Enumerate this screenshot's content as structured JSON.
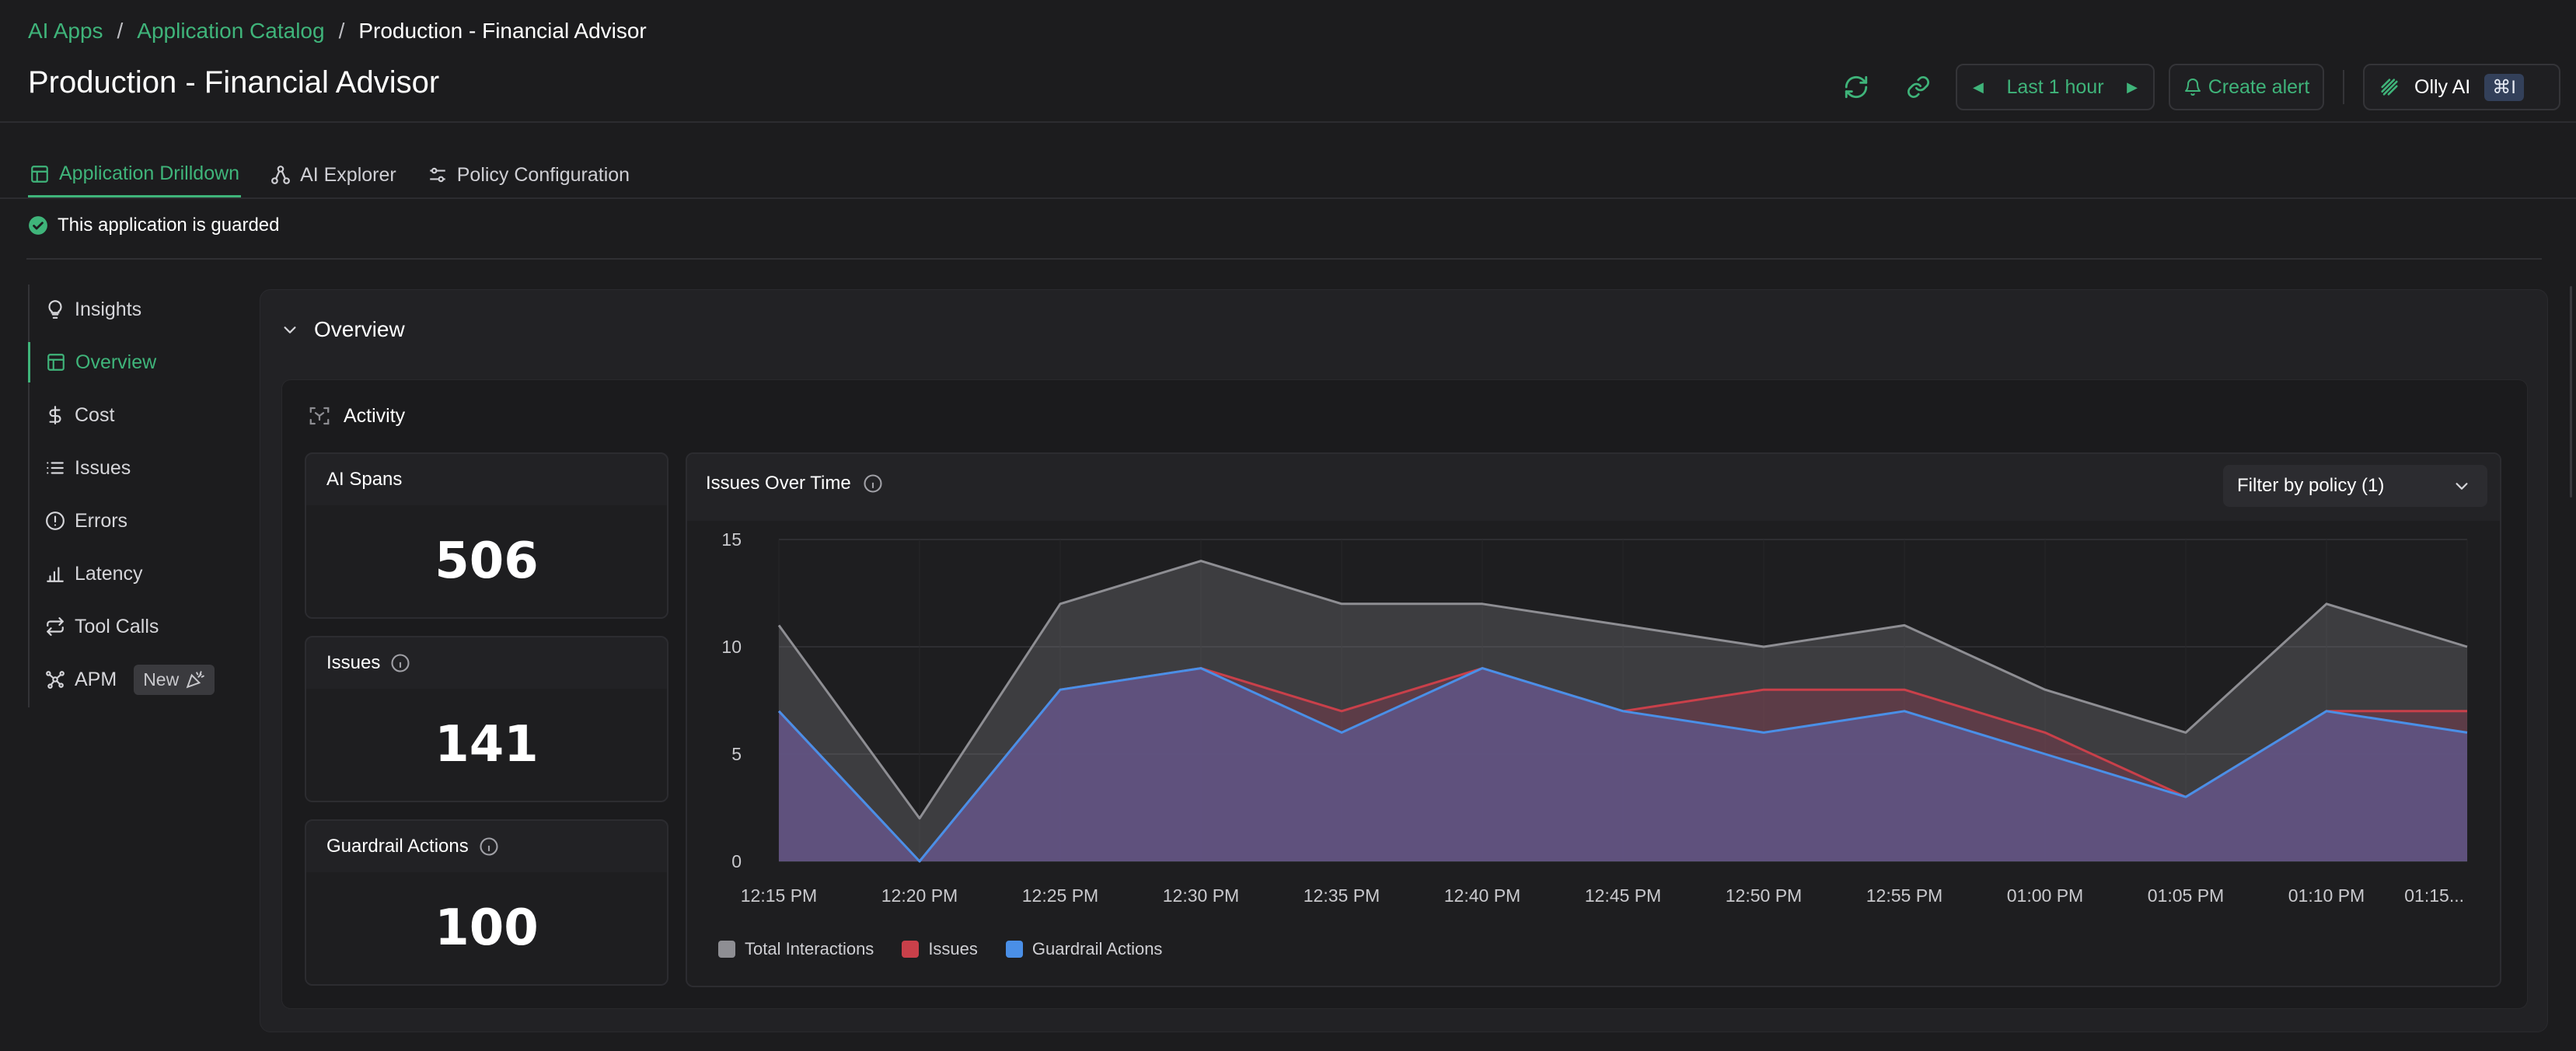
{
  "breadcrumb": {
    "items": [
      "AI Apps",
      "Application Catalog"
    ],
    "separator": "/",
    "current": "Production - Financial Advisor"
  },
  "page_title": "Production - Financial Advisor",
  "header": {
    "time_range": "Last 1 hour",
    "create_alert": "Create alert",
    "olly_label": "Olly AI",
    "olly_shortcut": "⌘I"
  },
  "tabs": [
    {
      "label": "Application Drilldown",
      "icon": "grid-icon",
      "active": true
    },
    {
      "label": "AI Explorer",
      "icon": "nodes-icon",
      "active": false
    },
    {
      "label": "Policy Configuration",
      "icon": "sliders-icon",
      "active": false
    }
  ],
  "guard_status": "This application is guarded",
  "sidebar": {
    "items": [
      {
        "label": "Insights",
        "icon": "lightbulb-icon"
      },
      {
        "label": "Overview",
        "icon": "grid-icon",
        "active": true
      },
      {
        "label": "Cost",
        "icon": "dollar-icon"
      },
      {
        "label": "Issues",
        "icon": "list-icon"
      },
      {
        "label": "Errors",
        "icon": "alert-circle-icon"
      },
      {
        "label": "Latency",
        "icon": "bar-chart-icon"
      },
      {
        "label": "Tool Calls",
        "icon": "repeat-icon"
      },
      {
        "label": "APM",
        "icon": "network-icon",
        "badge": "New"
      }
    ]
  },
  "overview": {
    "title": "Overview",
    "activity_title": "Activity",
    "metrics": [
      {
        "label": "AI Spans",
        "value": "506",
        "info": false
      },
      {
        "label": "Issues",
        "value": "141",
        "info": true
      },
      {
        "label": "Guardrail Actions",
        "value": "100",
        "info": true
      }
    ]
  },
  "chart": {
    "title": "Issues Over Time",
    "filter_label": "Filter by policy (1)"
  },
  "colors": {
    "accent": "#3fb47a",
    "total": "#8e8e93",
    "issues": "#c9404a",
    "guardrail": "#4a8fe7"
  },
  "chart_data": {
    "type": "area",
    "title": "Issues Over Time",
    "x": [
      "12:15 PM",
      "12:20 PM",
      "12:25 PM",
      "12:30 PM",
      "12:35 PM",
      "12:40 PM",
      "12:45 PM",
      "12:50 PM",
      "12:55 PM",
      "01:00 PM",
      "01:05 PM",
      "01:10 PM",
      "01:15..."
    ],
    "yticks": [
      0,
      5,
      10,
      15
    ],
    "ylim": [
      0,
      15
    ],
    "grid": true,
    "legend_position": "bottom-left",
    "series": [
      {
        "name": "Total Interactions",
        "color": "#8e8e93",
        "values": [
          11,
          2,
          12,
          14,
          12,
          12,
          11,
          10,
          11,
          8,
          6,
          12,
          10
        ]
      },
      {
        "name": "Issues",
        "color": "#c9404a",
        "values": [
          7,
          0,
          8,
          9,
          7,
          9,
          7,
          8,
          8,
          6,
          3,
          7,
          7
        ]
      },
      {
        "name": "Guardrail Actions",
        "color": "#4a8fe7",
        "values": [
          7,
          0,
          8,
          9,
          6,
          9,
          7,
          6,
          7,
          5,
          3,
          7,
          6
        ]
      }
    ]
  }
}
